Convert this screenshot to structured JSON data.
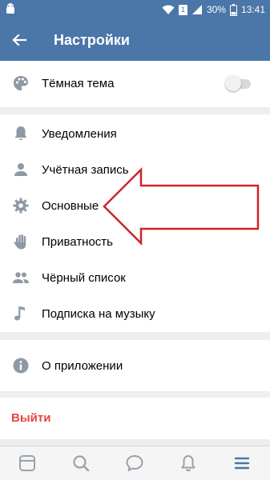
{
  "status_bar": {
    "battery": "30%",
    "time": "13:41",
    "sim_badge": "1"
  },
  "header": {
    "title": "Настройки"
  },
  "theme_section": {
    "dark_theme_label": "Тёмная тема",
    "dark_theme_enabled": false
  },
  "settings": {
    "items": [
      {
        "label": "Уведомления",
        "icon": "bell-icon"
      },
      {
        "label": "Учётная запись",
        "icon": "person-icon"
      },
      {
        "label": "Основные",
        "icon": "gear-icon"
      },
      {
        "label": "Приватность",
        "icon": "hand-icon"
      },
      {
        "label": "Чёрный список",
        "icon": "people-icon"
      },
      {
        "label": "Подписка на музыку",
        "icon": "music-note-icon"
      }
    ]
  },
  "about": {
    "label": "О приложении"
  },
  "logout": {
    "label": "Выйти"
  },
  "tab_bar": {
    "tabs": [
      "news-tab-icon",
      "search-icon",
      "messages-icon",
      "notifications-icon",
      "menu-icon"
    ],
    "active_color": "#4a76a8"
  },
  "colors": {
    "header_bg": "#4a76a8",
    "logout_text": "#e64646",
    "annotation_arrow": "#d0222a"
  }
}
